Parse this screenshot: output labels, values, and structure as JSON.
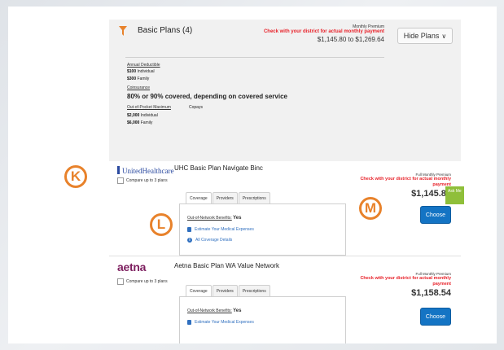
{
  "summary": {
    "title": "Basic Plans (4)",
    "premium_label": "Monthly Premium",
    "premium_note": "Check with your district for actual monthly payment",
    "premium_range": "$1,145.80 to $1,269.64",
    "hide_button": "Hide Plans",
    "deductible_label": "Annual Deductible",
    "deductible_individual": "$100",
    "deductible_individual_suffix": "Individual",
    "deductible_family": "$300",
    "deductible_family_suffix": "Family",
    "coinsurance_label": "Coinsurance",
    "coinsurance_value": "80% or 90% covered, depending on covered service",
    "oop_label": "Out-of-Pocket Maximum",
    "copays_label": "Copays",
    "oop_individual": "$2,000",
    "oop_individual_suffix": "Individual",
    "oop_family": "$6,000",
    "oop_family_suffix": "Family"
  },
  "plans": [
    {
      "logo": "UnitedHealthcare",
      "compare": "Compare up to 3 plans",
      "name": "UHC Basic Plan Navigate Binc",
      "tabs": [
        "Coverage",
        "Providers",
        "Prescriptions"
      ],
      "oon_label": "Out-of-Network Benefits:",
      "oon_value": "Yes",
      "link_estimate": "Estimate Your Medical Expenses",
      "link_details": "All Coverage Details",
      "premium_label": "Full Monthly Premium",
      "premium_note": "Check with your district for actual monthly payment",
      "price": "$1,145.80",
      "choose": "Choose"
    },
    {
      "logo": "aetna",
      "compare": "Compare up to 3 plans",
      "name": "Aetna Basic Plan WA Value Network",
      "tabs": [
        "Coverage",
        "Providers",
        "Prescriptions"
      ],
      "oon_label": "Out-of-Network Benefits:",
      "oon_value": "Yes",
      "link_estimate": "Estimate Your Medical Expenses",
      "premium_label": "Full Monthly Premium",
      "premium_note": "Check with your district for actual monthly payment",
      "price": "$1,158.54",
      "choose": "Choose"
    }
  ],
  "markers": {
    "k": "K",
    "l": "L",
    "m": "M"
  },
  "ask_me": "Ask Me",
  "colors": {
    "accent": "#1474c4",
    "warning": "#e8222a",
    "marker": "#e8822b",
    "funnel": "#e8822b"
  },
  "icons": {
    "filter": "funnel-icon",
    "chevron": "chevron-down-icon",
    "estimate": "calculator-icon",
    "details": "info-icon"
  }
}
